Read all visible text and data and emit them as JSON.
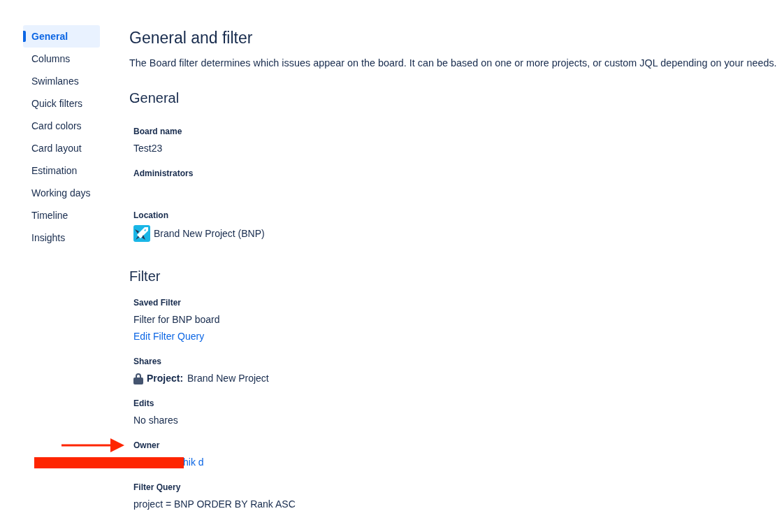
{
  "sidebar": {
    "items": [
      {
        "label": "General",
        "selected": true
      },
      {
        "label": "Columns",
        "selected": false
      },
      {
        "label": "Swimlanes",
        "selected": false
      },
      {
        "label": "Quick filters",
        "selected": false
      },
      {
        "label": "Card colors",
        "selected": false
      },
      {
        "label": "Card layout",
        "selected": false
      },
      {
        "label": "Estimation",
        "selected": false
      },
      {
        "label": "Working days",
        "selected": false
      },
      {
        "label": "Timeline",
        "selected": false
      },
      {
        "label": "Insights",
        "selected": false
      }
    ]
  },
  "page": {
    "title": "General and filter",
    "description": "The Board filter determines which issues appear on the board. It can be based on one or more projects, or custom JQL depending on your needs."
  },
  "sections": [
    {
      "heading": "General",
      "fields": [
        {
          "label": "Board name",
          "kind": "text",
          "value": "Test23"
        },
        {
          "label": "Administrators",
          "kind": "empty"
        },
        {
          "label": "Location",
          "kind": "project",
          "value": "Brand New Project (BNP)"
        }
      ]
    },
    {
      "heading": "Filter",
      "fields": [
        {
          "label": "Saved Filter",
          "kind": "text_link",
          "value": "Filter for BNP board",
          "link": "Edit Filter Query"
        },
        {
          "label": "Shares",
          "kind": "share",
          "value": "**Project:** Brand New Project"
        },
        {
          "label": "Edits",
          "kind": "text",
          "value": "No shares"
        },
        {
          "label": "Owner",
          "kind": "user_link",
          "value": "hik d",
          "pointed_at": true,
          "redacted": true
        },
        {
          "label": "Filter Query",
          "kind": "text",
          "value": "project = BNP ORDER BY Rank ASC"
        }
      ]
    }
  ]
}
